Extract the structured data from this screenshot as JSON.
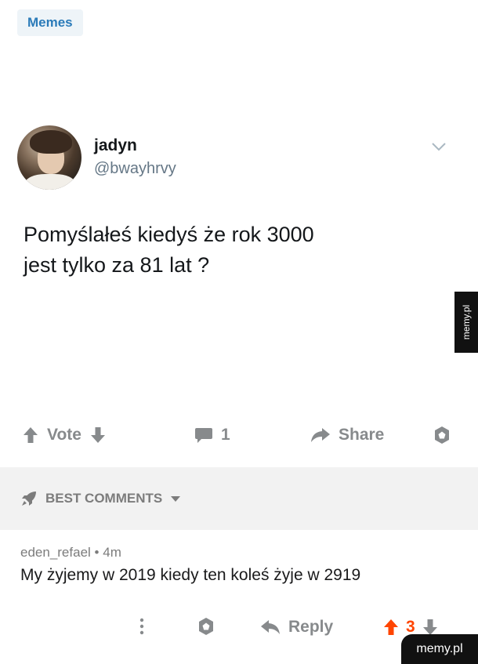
{
  "tag": "Memes",
  "tweet": {
    "display_name": "jadyn",
    "handle": "@bwayhrvy",
    "text_line1": "Pomyślałeś kiedyś że rok 3000",
    "text_line2": "jest tylko za 81 lat ?"
  },
  "actions": {
    "vote_label": "Vote",
    "comment_count": "1",
    "share_label": "Share"
  },
  "best_comments_label": "BEST COMMENTS",
  "comment": {
    "author": "eden_refael",
    "separator": "•",
    "age": "4m",
    "body": "My żyjemy w 2019 kiedy ten koleś żyje w 2919",
    "reply_label": "Reply",
    "score": "3"
  },
  "watermarks": {
    "side": "memy.pl",
    "footer": "memy.pl"
  },
  "colors": {
    "tag_text": "#2b7bb9",
    "upvote_active": "#ff4500",
    "icon_grey": "#878a8c"
  }
}
